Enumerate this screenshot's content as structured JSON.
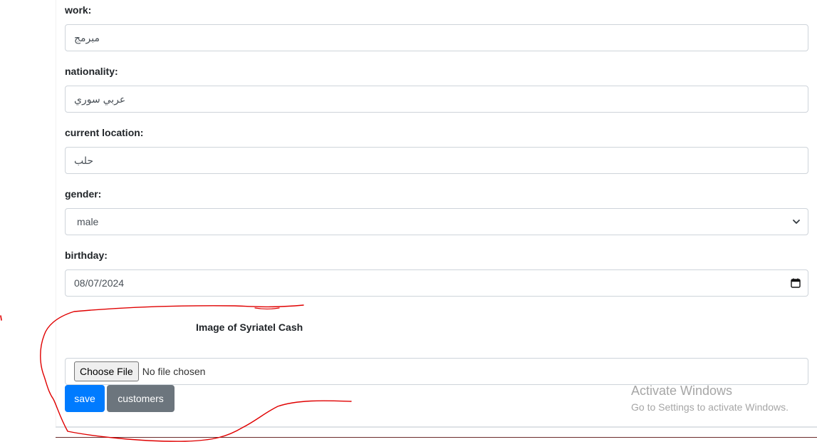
{
  "form": {
    "work": {
      "label": "work:",
      "value": "مبرمج"
    },
    "nationality": {
      "label": "nationality:",
      "value": "عربي سوري"
    },
    "current_location": {
      "label": "current location:",
      "value": "حلب"
    },
    "gender": {
      "label": "gender:",
      "selected": "male"
    },
    "birthday": {
      "label": "birthday:",
      "value": "08/07/2024"
    },
    "image_section": {
      "title": "Image of Syriatel Cash",
      "choose_file_label": "Choose File",
      "status": "No file chosen"
    }
  },
  "buttons": {
    "save": "save",
    "customers": "customers"
  },
  "watermark": {
    "line1": "Activate Windows",
    "line2": "Go to Settings to activate Windows."
  },
  "colors": {
    "primary": "#007bff",
    "secondary": "#6c757d",
    "annotation": "#e00000"
  },
  "icons": {
    "select_arrow": "chevron-down-icon",
    "date_picker": "calendar-icon"
  }
}
